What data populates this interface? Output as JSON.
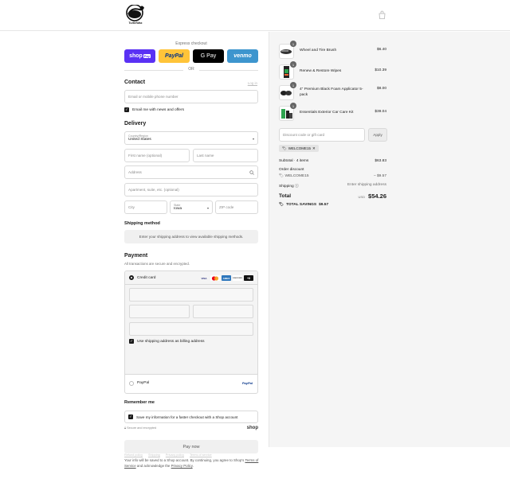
{
  "header": {
    "brand": "TurtleWax",
    "colors": {
      "accent": "#1a1a1a",
      "panel": "#f5f5f5"
    }
  },
  "express": {
    "label": "Express checkout",
    "buttons": {
      "shop": "shop",
      "shop_tag": "Pay",
      "paypal": "PayPal",
      "gpay": "G Pay",
      "venmo": "venmo"
    },
    "or": "OR"
  },
  "contact": {
    "title": "Contact",
    "login_link": "Log in",
    "email_placeholder": "Email or mobile phone number",
    "news_label": "Email me with news and offers",
    "news_checked": true
  },
  "delivery": {
    "title": "Delivery",
    "country_label": "Country/Region",
    "country_value": "United States",
    "first_name_placeholder": "First name (optional)",
    "last_name_placeholder": "Last name",
    "address_placeholder": "Address",
    "apartment_placeholder": "Apartment, suite, etc. (optional)",
    "city_placeholder": "City",
    "state_label": "State",
    "state_value": "Iowa",
    "zip_placeholder": "ZIP code"
  },
  "shipping_method": {
    "title": "Shipping method",
    "message": "Enter your shipping address to view available shipping methods."
  },
  "payment": {
    "title": "Payment",
    "subtitle": "All transactions are secure and encrypted.",
    "credit_card_label": "Credit card",
    "card_logos": [
      "VISA",
      "MC",
      "AMEX",
      "DISCOVER",
      "+8"
    ],
    "billing_label": "Use shipping address as billing address",
    "paypal_label": "PayPal",
    "paypal_logo": "PayPal"
  },
  "remember": {
    "title": "Remember me",
    "save_label": "Save my information for a faster checkout with a Shop account",
    "secure_text": "Secure and encrypted",
    "shop_logo": "shop"
  },
  "pay_now": "Pay now",
  "legal": {
    "text1": "Your info will be saved to a Shop account. By continuing, you agree to Shop's",
    "terms": "Terms of Service",
    "text2": "and acknowledge the",
    "privacy": "Privacy Policy",
    "end": "."
  },
  "footer_links": [
    "Refund policy",
    "Shipping",
    "Privacy policy",
    "Terms of service"
  ],
  "summary": {
    "items": [
      {
        "qty": "1",
        "name": "Wheel and Tire Brush",
        "price": "$6.40"
      },
      {
        "qty": "1",
        "name": "Renew & Restore Wipes",
        "price": "$10.39"
      },
      {
        "qty": "1",
        "name": "4\" Premium Black Foam Applicator 5-pack",
        "price": "$8.00"
      },
      {
        "qty": "1",
        "name": "Essentials Exterior Car Care Kit",
        "price": "$39.04"
      }
    ],
    "discount_placeholder": "Discount code or gift card",
    "apply_label": "Apply",
    "applied_code": "WELCOME15",
    "subtotal_label": "Subtotal · 4 items",
    "subtotal_value": "$63.83",
    "order_discount_label": "Order discount",
    "discount_code": "WELCOME15",
    "discount_value": "– $9.57",
    "shipping_label": "Shipping",
    "shipping_value": "Enter shipping address",
    "total_label": "Total",
    "currency": "USD",
    "total_value": "$54.26",
    "savings_label": "TOTAL SAVINGS",
    "savings_value": "$9.57"
  }
}
